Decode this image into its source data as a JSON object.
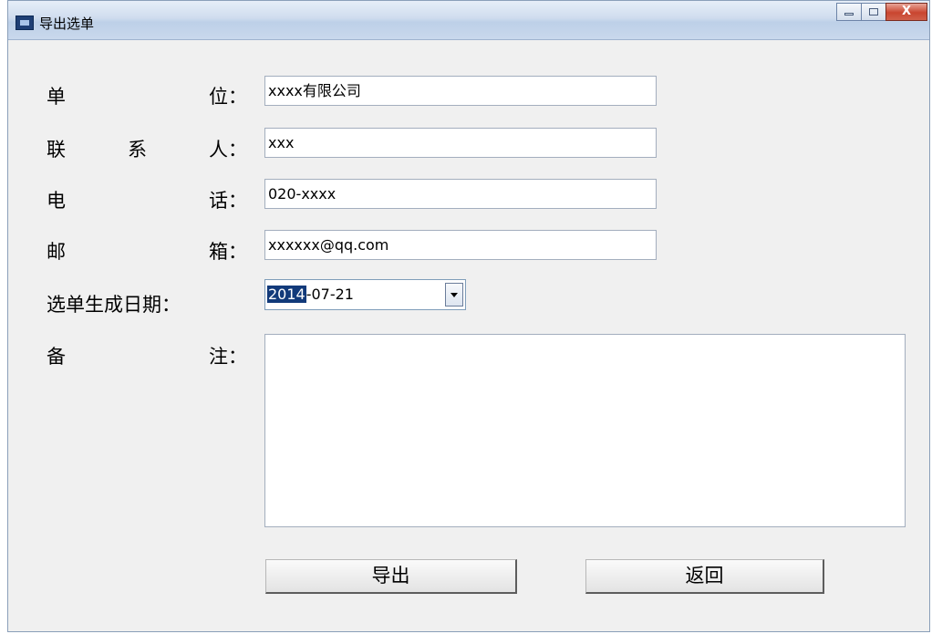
{
  "window": {
    "title": "导出选单",
    "icons": {
      "app": "app-logo-icon",
      "minimize": "minimize-icon",
      "maximize": "maximize-icon",
      "close": "close-icon"
    },
    "close_glyph": "X"
  },
  "form": {
    "company": {
      "label_chars": [
        "单",
        "位："
      ],
      "value": "xxxx有限公司"
    },
    "contact": {
      "label_chars": [
        "联",
        "系",
        "人："
      ],
      "value": "xxx"
    },
    "phone": {
      "label_chars": [
        "电",
        "话："
      ],
      "value": "020-xxxx"
    },
    "email": {
      "label_chars": [
        "邮",
        "箱："
      ],
      "value": "xxxxxx@qq.com"
    },
    "date": {
      "label": "选单生成日期：",
      "selected_part": "2014",
      "rest": "-07-21"
    },
    "notes": {
      "label_chars": [
        "备",
        "注："
      ],
      "value": ""
    }
  },
  "buttons": {
    "export": "导出",
    "back": "返回"
  },
  "colors": {
    "title_bar": "#c9d8ec",
    "close_button": "#c9452f",
    "selection": "#123a7a",
    "window_bg": "#f0f0f0"
  }
}
